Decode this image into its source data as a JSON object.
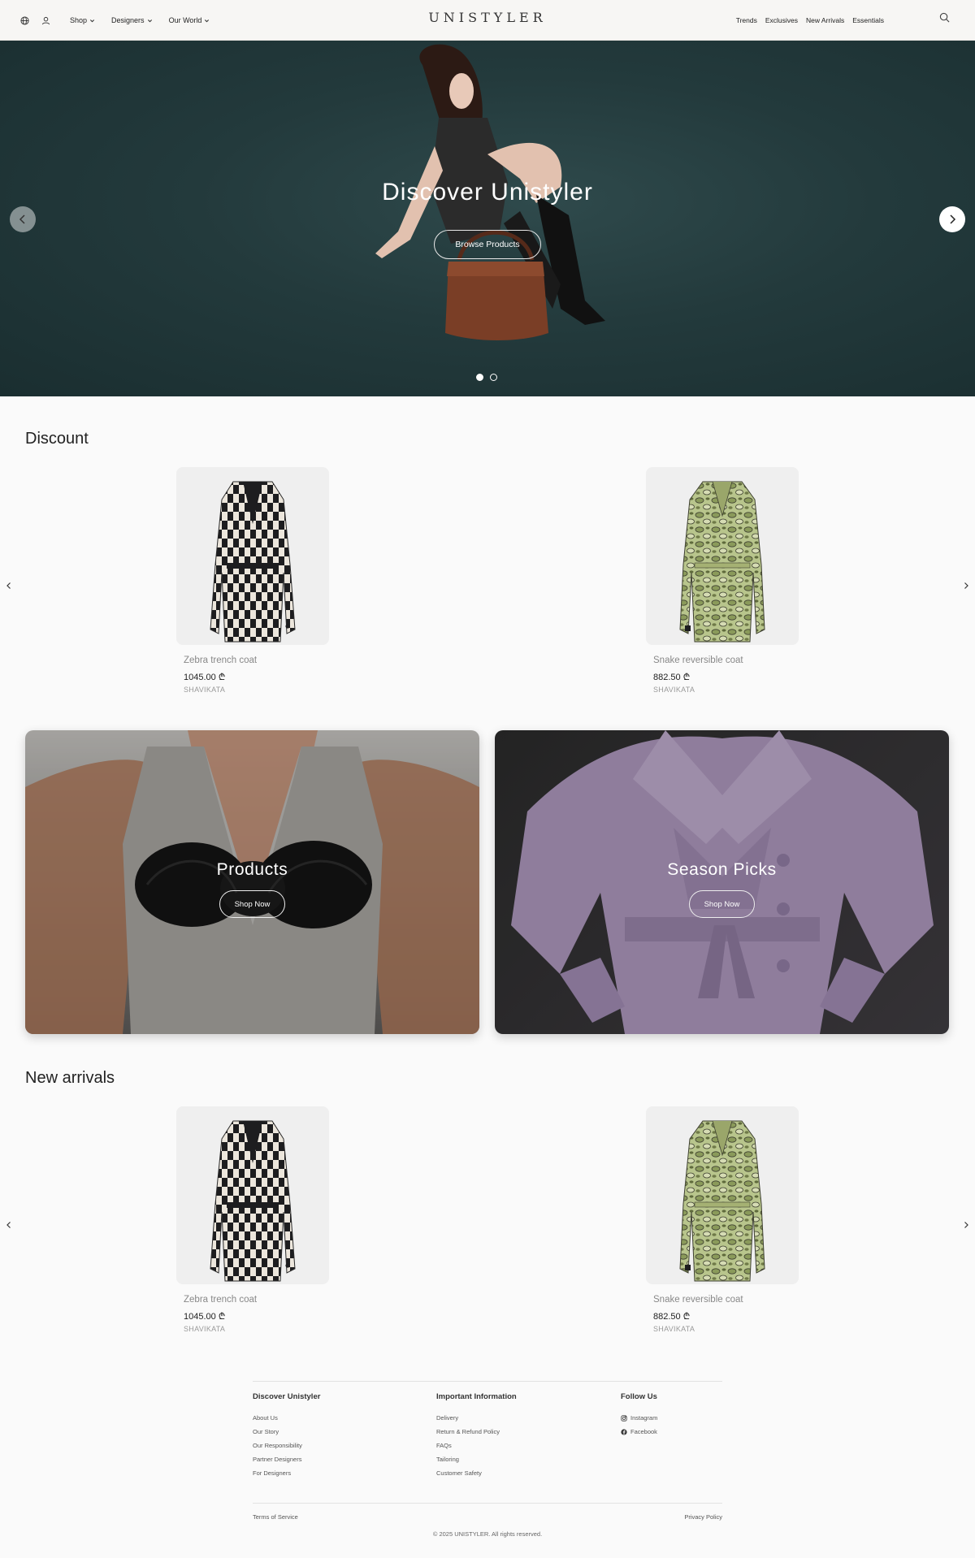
{
  "header": {
    "logo": "UNISTYLER",
    "nav_left": [
      {
        "label": "Shop"
      },
      {
        "label": "Designers"
      },
      {
        "label": "Our World"
      }
    ],
    "nav_right": [
      {
        "label": "Trends"
      },
      {
        "label": "Exclusives"
      },
      {
        "label": "New Arrivals"
      },
      {
        "label": "Essentials"
      }
    ]
  },
  "hero": {
    "title": "Discover Unistyler",
    "button_label": "Browse Products",
    "slide_count": 2,
    "active_slide": 1
  },
  "discount": {
    "title": "Discount",
    "products": [
      {
        "name": "Zebra trench coat",
        "price": "1045.00 ₾",
        "brand": "SHAVIKATA"
      },
      {
        "name": "Snake reversible coat",
        "price": "882.50 ₾",
        "brand": "SHAVIKATA"
      }
    ]
  },
  "banners": [
    {
      "title": "Products",
      "button_label": "Shop Now"
    },
    {
      "title": "Season Picks",
      "button_label": "Shop Now"
    }
  ],
  "new_arrivals": {
    "title": "New arrivals",
    "products": [
      {
        "name": "Zebra trench coat",
        "price": "1045.00 ₾",
        "brand": "SHAVIKATA"
      },
      {
        "name": "Snake reversible coat",
        "price": "882.50 ₾",
        "brand": "SHAVIKATA"
      }
    ]
  },
  "footer": {
    "columns": [
      {
        "heading": "Discover Unistyler",
        "links": [
          "About Us",
          "Our Story",
          "Our Responsibility",
          "Partner Designers",
          "For Designers"
        ]
      },
      {
        "heading": "Important Information",
        "links": [
          "Delivery",
          "Return & Refund Policy",
          "FAQs",
          "Tailoring",
          "Customer Safety"
        ]
      },
      {
        "heading": "Follow Us",
        "links": [
          "Instagram",
          "Facebook"
        ]
      }
    ],
    "terms": "Terms of Service",
    "privacy": "Privacy Policy",
    "copyright": "© 2025 UNISTYLER. All rights reserved."
  },
  "colors": {
    "background": "#fafafa",
    "header_bg": "#f7f6f4",
    "hero_bg": "#233a3c",
    "text": "#222222"
  },
  "icons": [
    "globe-icon",
    "user-icon",
    "chevron-down-icon",
    "search-icon",
    "chevron-left-icon",
    "chevron-right-icon",
    "instagram-icon",
    "facebook-icon"
  ]
}
